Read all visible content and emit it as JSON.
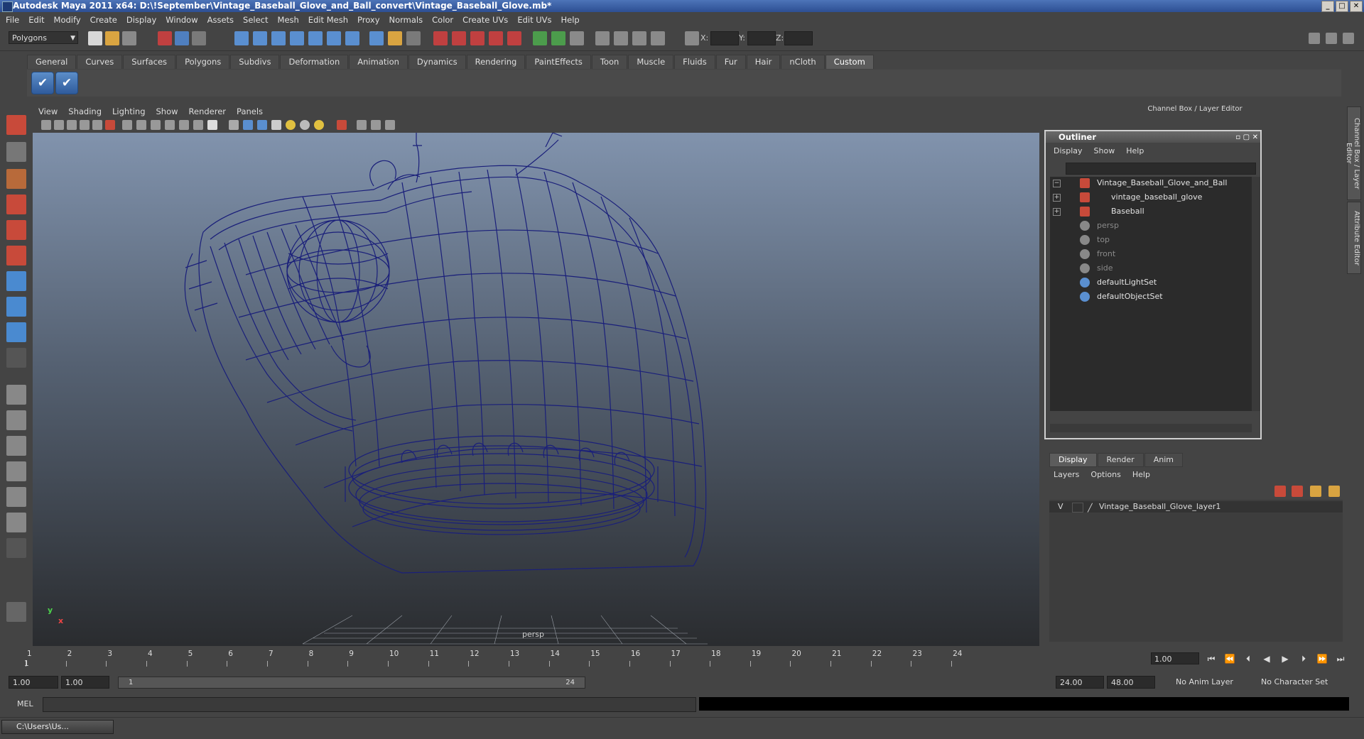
{
  "window": {
    "title": "Autodesk Maya 2011 x64: D:\\!September\\Vintage_Baseball_Glove_and_Ball_convert\\Vintage_Baseball_Glove.mb*",
    "controls": [
      "_",
      "□",
      "✕"
    ]
  },
  "menu": [
    "File",
    "Edit",
    "Modify",
    "Create",
    "Display",
    "Window",
    "Assets",
    "Select",
    "Mesh",
    "Edit Mesh",
    "Proxy",
    "Normals",
    "Color",
    "Create UVs",
    "Edit UVs",
    "Help"
  ],
  "status": {
    "mode": "Polygons",
    "x_label": "X:",
    "y_label": "Y:",
    "z_label": "Z:"
  },
  "shelf": {
    "tabs": [
      "General",
      "Curves",
      "Surfaces",
      "Polygons",
      "Subdivs",
      "Deformation",
      "Animation",
      "Dynamics",
      "Rendering",
      "PaintEffects",
      "Toon",
      "Muscle",
      "Fluids",
      "Fur",
      "Hair",
      "nCloth",
      "Custom"
    ],
    "active_tab": "Custom",
    "check_glyph": "✔"
  },
  "viewport": {
    "menu": [
      "View",
      "Shading",
      "Lighting",
      "Show",
      "Renderer",
      "Panels"
    ],
    "camera_label": "persp",
    "axis_y": "y",
    "axis_x": "x",
    "wire_color": "#1a1f7a"
  },
  "channel_box": {
    "title": "Channel Box / Layer Editor",
    "side_tabs": [
      "Channel Box / Layer Editor",
      "Attribute Editor"
    ]
  },
  "outliner": {
    "title": "Outliner",
    "menu": [
      "Display",
      "Show",
      "Help"
    ],
    "items": [
      {
        "label": "Vintage_Baseball_Glove_and_Ball",
        "type": "mesh",
        "expander": "−",
        "indent": 0,
        "dim": false
      },
      {
        "label": "vintage_baseball_glove",
        "type": "mesh",
        "expander": "+",
        "indent": 1,
        "dim": false
      },
      {
        "label": "Baseball",
        "type": "mesh",
        "expander": "+",
        "indent": 1,
        "dim": false
      },
      {
        "label": "persp",
        "type": "camera",
        "expander": "",
        "indent": 0,
        "dim": true
      },
      {
        "label": "top",
        "type": "camera",
        "expander": "",
        "indent": 0,
        "dim": true
      },
      {
        "label": "front",
        "type": "camera",
        "expander": "",
        "indent": 0,
        "dim": true
      },
      {
        "label": "side",
        "type": "camera",
        "expander": "",
        "indent": 0,
        "dim": true
      },
      {
        "label": "defaultLightSet",
        "type": "set",
        "expander": "",
        "indent": 0,
        "dim": false
      },
      {
        "label": "defaultObjectSet",
        "type": "set",
        "expander": "",
        "indent": 0,
        "dim": false
      }
    ]
  },
  "layers": {
    "tabs": [
      "Display",
      "Render",
      "Anim"
    ],
    "active_tab": "Display",
    "menu": [
      "Layers",
      "Options",
      "Help"
    ],
    "rows": [
      {
        "visible": "V",
        "name": "Vintage_Baseball_Glove_layer1"
      }
    ]
  },
  "timeline": {
    "ticks": [
      1,
      2,
      3,
      4,
      5,
      6,
      7,
      8,
      9,
      10,
      11,
      12,
      13,
      14,
      15,
      16,
      17,
      18,
      19,
      20,
      21,
      22,
      23,
      24
    ],
    "current_marker": "1",
    "current_frame": "1.00",
    "playback": [
      "⏮",
      "⏪",
      "⏴",
      "◀",
      "▶",
      "⏵",
      "⏩",
      "⏭"
    ]
  },
  "range": {
    "start": "1.00",
    "playback_start": "1.00",
    "slider_start": "1",
    "slider_end": "24",
    "playback_end": "24.00",
    "end": "48.00",
    "anim_layer": "No Anim Layer",
    "character_set": "No Character Set"
  },
  "command": {
    "label": "MEL"
  },
  "taskbar": {
    "item": "C:\\Users\\Us..."
  }
}
